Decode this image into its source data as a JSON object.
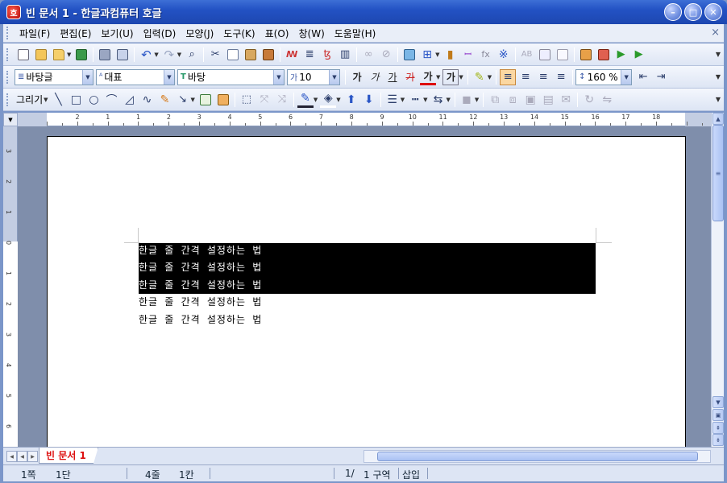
{
  "window": {
    "title": "빈 문서 1 - 한글과컴퓨터 호글",
    "app_icon": "호",
    "minimize": "–",
    "maximize": "□",
    "close": "✕"
  },
  "menu": {
    "items": [
      "파일(F)",
      "편집(E)",
      "보기(U)",
      "입력(D)",
      "모양(J)",
      "도구(K)",
      "표(O)",
      "창(W)",
      "도움말(H)"
    ],
    "close": "×"
  },
  "format_bar": {
    "style": "바탕글",
    "lang": "대표",
    "font": "바탕",
    "font_size": "10",
    "line_spacing": "160 %",
    "char_buttons": [
      "가",
      "가",
      "가",
      "가",
      "가",
      "가"
    ]
  },
  "draw_bar": {
    "label": "그리기"
  },
  "ruler": {
    "h_labels": [
      "2",
      "1",
      "1",
      "2",
      "3",
      "4",
      "5",
      "6",
      "7",
      "8",
      "9",
      "10",
      "11",
      "12",
      "13",
      "14",
      "15",
      "16",
      "17",
      "18"
    ],
    "v_labels": [
      "3",
      "2",
      "1",
      "0",
      "1",
      "2",
      "3",
      "4",
      "5",
      "6"
    ]
  },
  "document": {
    "lines": [
      "한글 줄 간격 설정하는 법",
      "한글 줄 간격 설정하는 법",
      "한글 줄 간격 설정하는 법",
      "한글 줄 간격 설정하는 법",
      "한글 줄 간격 설정하는 법"
    ],
    "selected_count": 3
  },
  "tabs": {
    "doc_tab": "빈 문서 1"
  },
  "status": {
    "page": "1쪽",
    "column": "1단",
    "line": "4줄",
    "col_pos": "1칸",
    "section_prefix": "1/",
    "section": "1 구역",
    "mode": "삽입"
  }
}
